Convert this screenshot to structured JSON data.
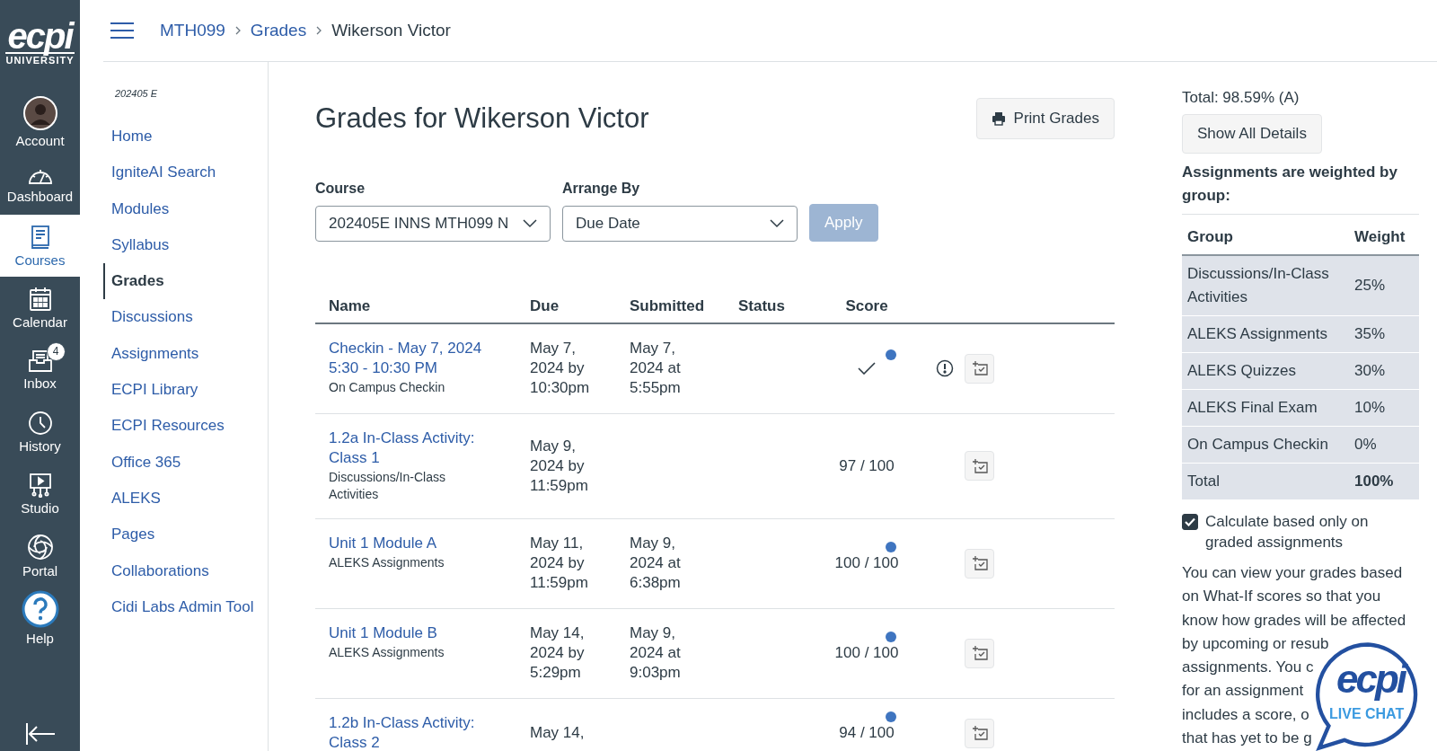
{
  "global_nav": {
    "logo": {
      "text": "ecpi",
      "subtext": "UNIVERSITY"
    },
    "items": [
      {
        "label": "Account",
        "selected": false
      },
      {
        "label": "Dashboard",
        "selected": false
      },
      {
        "label": "Courses",
        "selected": true
      },
      {
        "label": "Calendar",
        "selected": false
      },
      {
        "label": "Inbox",
        "selected": false,
        "badge": "4"
      },
      {
        "label": "History",
        "selected": false
      },
      {
        "label": "Studio",
        "selected": false
      },
      {
        "label": "Portal",
        "selected": false
      },
      {
        "label": "Help",
        "selected": false
      }
    ]
  },
  "breadcrumb": [
    "MTH099",
    "Grades",
    "Wikerson Victor"
  ],
  "course_nav": {
    "term": "202405 E",
    "items": [
      {
        "label": "Home",
        "selected": false
      },
      {
        "label": "IgniteAI Search",
        "selected": false
      },
      {
        "label": "Modules",
        "selected": false
      },
      {
        "label": "Syllabus",
        "selected": false
      },
      {
        "label": "Grades",
        "selected": true
      },
      {
        "label": "Discussions",
        "selected": false
      },
      {
        "label": "Assignments",
        "selected": false
      },
      {
        "label": "ECPI Library",
        "selected": false
      },
      {
        "label": "ECPI Resources",
        "selected": false
      },
      {
        "label": "Office 365",
        "selected": false
      },
      {
        "label": "ALEKS",
        "selected": false
      },
      {
        "label": "Pages",
        "selected": false
      },
      {
        "label": "Collaborations",
        "selected": false
      },
      {
        "label": "Cidi Labs Admin Tool",
        "selected": false
      }
    ]
  },
  "page": {
    "title": "Grades for Wikerson Victor",
    "print_button": "Print Grades",
    "filters": [
      {
        "label": "Course",
        "value": "202405E INNS MTH099 N"
      },
      {
        "label": "Arrange By",
        "value": "Due Date"
      }
    ],
    "apply_button": {
      "label": "Apply",
      "disabled": true
    }
  },
  "table": {
    "columns": [
      "Name",
      "Due",
      "Submitted",
      "Status",
      "Score"
    ],
    "rows": [
      {
        "name": "Checkin - May 7, 2024 5:30 - 10:30 PM",
        "group": "On Campus Checkin",
        "due": "May 7, 2024 by 10:30pm",
        "submitted": "May 7, 2024 at 5:55pm",
        "kind": "complete",
        "new": true,
        "warning": true
      },
      {
        "name": "1.2a In-Class Activity: Class 1",
        "group": "Discussions/In-Class Activities",
        "due": "May 9, 2024 by 11:59pm",
        "kind": "points",
        "score": "97 / 100",
        "new": false,
        "warning": false
      },
      {
        "name": "Unit 1 Module A",
        "group": "ALEKS Assignments",
        "due": "May 11, 2024 by 11:59pm",
        "submitted": "May 9, 2024 at 6:38pm",
        "kind": "points",
        "score": "100 / 100",
        "new": true,
        "warning": false
      },
      {
        "name": "Unit 1 Module B",
        "group": "ALEKS Assignments",
        "due": "May 14, 2024 by 5:29pm",
        "submitted": "May 9, 2024 at 9:03pm",
        "kind": "points",
        "score": "100 / 100",
        "new": true,
        "warning": false
      },
      {
        "name": "1.2b In-Class Activity: Class 2",
        "due": "May 14,",
        "kind": "points",
        "score": "94 / 100",
        "new": true,
        "warning": false
      }
    ]
  },
  "sidebar": {
    "total": "Total: 98.59% (A)",
    "show_details": "Show All Details",
    "weight_note": "Assignments are weighted by group:",
    "weights": {
      "columns": [
        "Group",
        "Weight"
      ],
      "rows": [
        {
          "group": "Discussions/In-Class Activities",
          "weight": "25%"
        },
        {
          "group": "ALEKS Assignments",
          "weight": "35%"
        },
        {
          "group": "ALEKS Quizzes",
          "weight": "30%"
        },
        {
          "group": "ALEKS Final Exam",
          "weight": "10%"
        },
        {
          "group": "On Campus Checkin",
          "weight": "0%"
        }
      ],
      "total": {
        "group": "Total",
        "weight": "100%"
      }
    },
    "calc": {
      "label": "Calculate based only on graded assignments",
      "checked": true
    },
    "help_lines": [
      "You can view your grades based",
      "on What-If scores so that you",
      "know how grades will be affected",
      "by upcoming or resub",
      "assignments. You c",
      "for an assignment",
      "includes a score, o",
      "that has yet to be g"
    ]
  },
  "chat_widget": {
    "logo": "ecpi",
    "label": "LIVE CHAT"
  }
}
